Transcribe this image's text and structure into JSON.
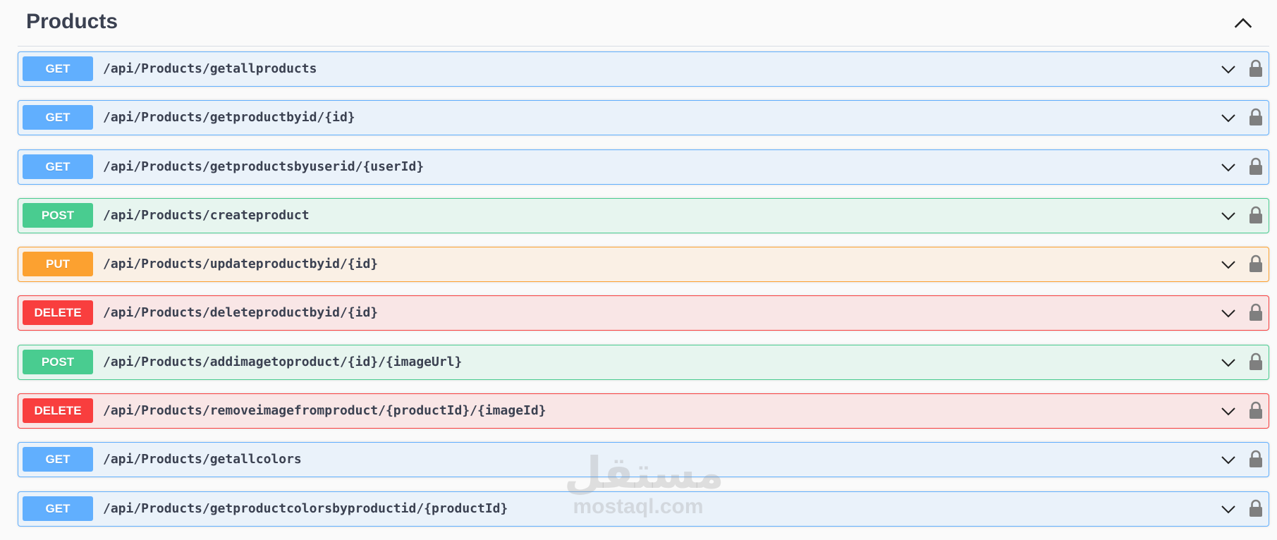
{
  "section": {
    "title": "Products"
  },
  "operations": [
    {
      "method": "GET",
      "path": "/api/Products/getallproducts"
    },
    {
      "method": "GET",
      "path": "/api/Products/getproductbyid/{id}"
    },
    {
      "method": "GET",
      "path": "/api/Products/getproductsbyuserid/{userId}"
    },
    {
      "method": "POST",
      "path": "/api/Products/createproduct"
    },
    {
      "method": "PUT",
      "path": "/api/Products/updateproductbyid/{id}"
    },
    {
      "method": "DELETE",
      "path": "/api/Products/deleteproductbyid/{id}"
    },
    {
      "method": "POST",
      "path": "/api/Products/addimagetoproduct/{id}/{imageUrl}"
    },
    {
      "method": "DELETE",
      "path": "/api/Products/removeimagefromproduct/{productId}/{imageId}"
    },
    {
      "method": "GET",
      "path": "/api/Products/getallcolors"
    },
    {
      "method": "GET",
      "path": "/api/Products/getproductcolorsbyproductid/{productId}"
    }
  ],
  "method_colors": {
    "GET": "#61affe",
    "POST": "#49cc90",
    "PUT": "#fca130",
    "DELETE": "#f93e3e"
  },
  "icons": {
    "collapse": "chevron-up-icon",
    "expand": "chevron-down-icon",
    "auth": "lock-icon"
  },
  "watermark": {
    "logo": "مستقل",
    "text": "mostaql.com"
  }
}
